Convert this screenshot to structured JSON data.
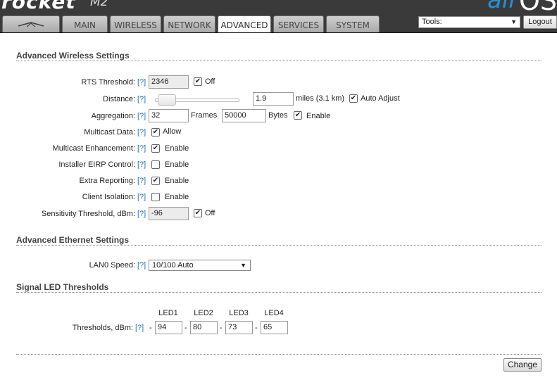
{
  "header": {
    "brand": "rocket",
    "model": "M2",
    "os_name": "air",
    "os_version": "OS"
  },
  "tabs": [
    {
      "label": "",
      "icon": "ubiquiti-logo-icon"
    },
    {
      "label": "MAIN"
    },
    {
      "label": "WIRELESS"
    },
    {
      "label": "NETWORK"
    },
    {
      "label": "ADVANCED",
      "active": true
    },
    {
      "label": "SERVICES"
    },
    {
      "label": "SYSTEM"
    }
  ],
  "tools": {
    "label": "Tools:",
    "logout": "Logout"
  },
  "help": "[?]",
  "wireless": {
    "title": "Advanced Wireless Settings",
    "rts_label": "RTS Threshold:",
    "rts_value": "2346",
    "rts_off": "Off",
    "rts_off_checked": true,
    "distance_label": "Distance:",
    "distance_value": "1.9",
    "distance_units": "miles (3.1 km)",
    "distance_slider_fraction": 0.05,
    "auto_adjust": "Auto Adjust",
    "auto_adjust_checked": true,
    "aggregation_label": "Aggregation:",
    "aggregation_frames": "32",
    "frames_label": "Frames",
    "aggregation_bytes": "50000",
    "bytes_label": "Bytes",
    "aggregation_enable": "Enable",
    "aggregation_enable_checked": true,
    "multicast_label": "Multicast Data:",
    "multicast_allow": "Allow",
    "multicast_checked": true,
    "mcast_enh_label": "Multicast Enhancement:",
    "mcast_enh_enable": "Enable",
    "mcast_enh_checked": true,
    "eirp_label": "Installer EIRP Control:",
    "eirp_enable": "Enable",
    "eirp_checked": false,
    "extra_label": "Extra Reporting:",
    "extra_enable": "Enable",
    "extra_checked": true,
    "isolation_label": "Client Isolation:",
    "isolation_enable": "Enable",
    "isolation_checked": false,
    "sens_label": "Sensitivity Threshold, dBm:",
    "sens_value": "-96",
    "sens_off": "Off",
    "sens_off_checked": true
  },
  "ethernet": {
    "title": "Advanced Ethernet Settings",
    "lan_label": "LAN0 Speed:",
    "lan_value": "10/100 Auto"
  },
  "led": {
    "title": "Signal LED Thresholds",
    "headers": [
      "LED1",
      "LED2",
      "LED3",
      "LED4"
    ],
    "label": "Thresholds, dBm:",
    "values": [
      "94",
      "80",
      "73",
      "65"
    ],
    "sep": "-"
  },
  "change_button": "Change",
  "colors": {
    "accent": "#2673b8",
    "header": "#3a3a3a"
  }
}
